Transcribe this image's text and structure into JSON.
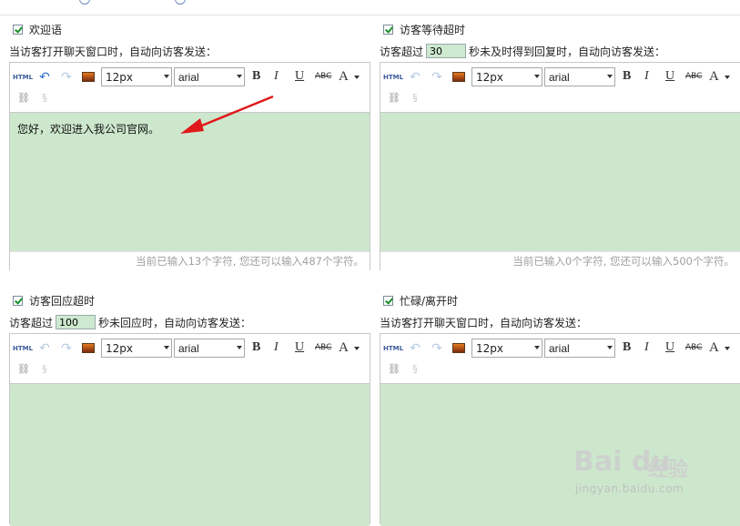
{
  "panels": [
    {
      "id": "welcome",
      "title": "欢迎语",
      "desc_prefix": "当访客打开聊天窗口时，自动向访客发送：",
      "content_text": "您好，欢迎进入我公司官网。",
      "footer": "当前已输入13个字符, 您还可以输入487个字符。"
    },
    {
      "id": "wait-timeout",
      "title": "访客等待超时",
      "desc_prefix": "访客超过",
      "input_value": "30",
      "desc_suffix": "秒未及时得到回复时，自动向访客发送：",
      "content_text": "",
      "footer": "当前已输入0个字符, 您还可以输入500个字符。"
    },
    {
      "id": "reply-timeout",
      "title": "访客回应超时",
      "desc_prefix": "访客超过",
      "input_value": "100",
      "desc_suffix": "秒未回应时，自动向访客发送：",
      "content_text": ""
    },
    {
      "id": "busy-away",
      "title": "忙碌/离开时",
      "desc_prefix": "当访客打开聊天窗口时，自动向访客发送：",
      "content_text": ""
    }
  ],
  "toolbar": {
    "html_label": "HTML",
    "font_size": "12px",
    "font_family": "arial",
    "bold": "B",
    "italic": "I",
    "underline": "U",
    "strike": "ABC",
    "font_color": "A"
  },
  "icons": {
    "undo": "undo-icon",
    "redo": "redo-icon",
    "image": "image-icon",
    "link": "link-icon",
    "unlink": "unlink-icon"
  },
  "watermark": {
    "brand": "Bai du",
    "cn": "经验",
    "url": "jingyan.baidu.com"
  },
  "colors": {
    "editor_bg": "#cde7cd",
    "checkbox_mark": "#1a8f2a",
    "arrow": "#e0191a"
  }
}
